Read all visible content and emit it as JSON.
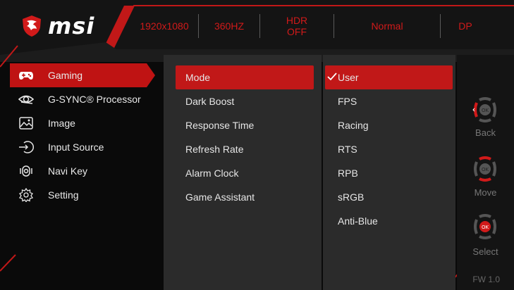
{
  "brand": {
    "logo_text": "msi"
  },
  "status": {
    "resolution": "1920x1080",
    "refresh": "360HZ",
    "hdr_line1": "HDR",
    "hdr_line2": "OFF",
    "mode": "Normal",
    "input": "DP"
  },
  "menu": {
    "items": [
      {
        "label": "Gaming",
        "icon": "gamepad-icon"
      },
      {
        "label": "G-SYNC® Processor",
        "icon": "gsync-icon"
      },
      {
        "label": "Image",
        "icon": "image-icon"
      },
      {
        "label": "Input Source",
        "icon": "input-icon"
      },
      {
        "label": "Navi Key",
        "icon": "joystick-icon"
      },
      {
        "label": "Setting",
        "icon": "gear-icon"
      }
    ],
    "active": "Gaming"
  },
  "submenu": {
    "items": [
      "Mode",
      "Dark Boost",
      "Response Time",
      "Refresh Rate",
      "Alarm Clock",
      "Game Assistant"
    ],
    "active": "Mode"
  },
  "options": {
    "items": [
      "User",
      "FPS",
      "Racing",
      "RTS",
      "RPB",
      "sRGB",
      "Anti-Blue"
    ],
    "selected": "User"
  },
  "nav": {
    "back": "Back",
    "move": "Move",
    "select": "Select",
    "ok": "OK",
    "fw": "FW 1.0"
  },
  "colors": {
    "accent": "#bf1313",
    "status_text": "#d11a1a",
    "panel": "#2b2b2b"
  }
}
